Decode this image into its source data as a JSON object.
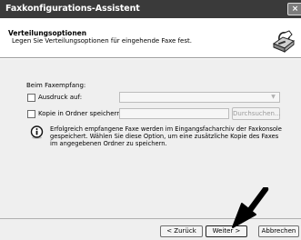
{
  "window": {
    "title": "Faxkonfigurations-Assistent",
    "close_label": "×"
  },
  "header": {
    "title": "Verteilungsoptionen",
    "subtitle": "Legen Sie Verteilungsoptionen für eingehende Faxe fest.",
    "icon": "fax-wizard-icon"
  },
  "form": {
    "section_label": "Beim Faxempfang:",
    "print_checkbox": {
      "label": "Ausdruck auf:",
      "checked": false
    },
    "printer_select": {
      "value": "",
      "enabled": false
    },
    "copy_checkbox": {
      "label": "Kopie in Ordner speichern:",
      "checked": false
    },
    "folder_input": {
      "value": "",
      "enabled": false
    },
    "browse_label": "Durchsuchen...",
    "info_icon": "info-icon",
    "info_text": "Erfolgreich empfangene Faxe werden im Eingangsfacharchiv der Faxkonsole gespeichert. Wählen Sie diese Option, um eine zusätzliche Kopie des Faxes im angegebenen Ordner zu speichern."
  },
  "footer": {
    "back_label": "< Zurück",
    "next_label": "Weiter >",
    "cancel_label": "Abbrechen"
  },
  "colors": {
    "titlebar": "#3a3a3a",
    "body": "#efefef",
    "pointer": "#000000"
  }
}
